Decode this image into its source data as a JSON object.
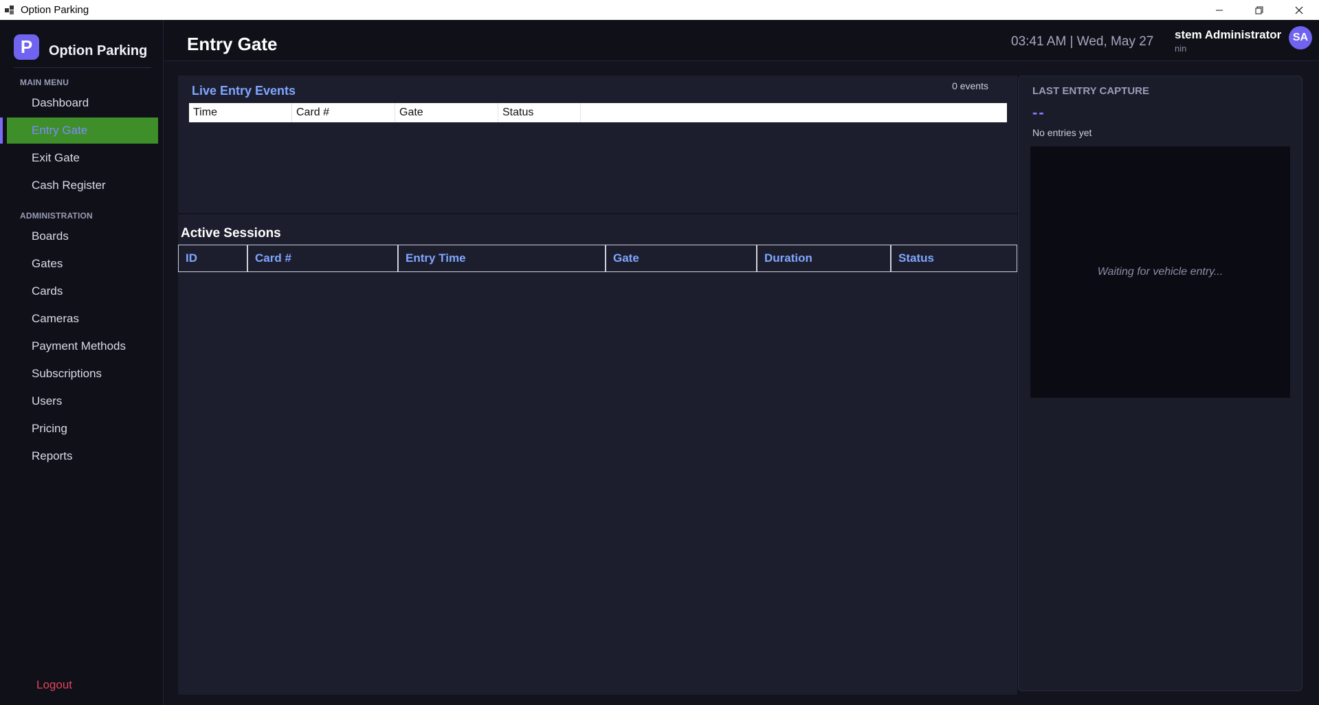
{
  "window": {
    "title": "Option Parking",
    "icon": "app-window-icon"
  },
  "brand": {
    "logo_letter": "P",
    "name": "Option Parking",
    "accent": "#6f63f0"
  },
  "sidebar": {
    "main_menu_label": "MAIN MENU",
    "main_items": [
      {
        "label": "Dashboard"
      },
      {
        "label": "Entry Gate",
        "active": true
      },
      {
        "label": "Exit Gate"
      },
      {
        "label": "Cash Register"
      }
    ],
    "admin_label": "ADMINISTRATION",
    "admin_items": [
      {
        "label": "Boards"
      },
      {
        "label": "Gates"
      },
      {
        "label": "Cards"
      },
      {
        "label": "Cameras"
      },
      {
        "label": "Payment Methods"
      },
      {
        "label": "Subscriptions"
      },
      {
        "label": "Users"
      },
      {
        "label": "Pricing"
      },
      {
        "label": "Reports"
      }
    ],
    "logout_label": "Logout",
    "active_color": "#3e8e2a"
  },
  "header": {
    "title": "Entry Gate",
    "clock": "03:41 AM  |  Wed, May 27",
    "user_name": "stem Administrator",
    "user_role": "nin",
    "avatar_initials": "SA"
  },
  "live_events": {
    "title": "Live Entry Events",
    "count_label": "0 events",
    "columns": [
      "Time",
      "Card #",
      "Gate",
      "Status"
    ]
  },
  "sessions": {
    "title": "Active Sessions",
    "columns": [
      "ID",
      "Card #",
      "Entry Time",
      "Gate",
      "Duration",
      "Status"
    ]
  },
  "capture": {
    "title": "LAST ENTRY CAPTURE",
    "plate": "--",
    "subtitle": "No entries yet",
    "placeholder": "Waiting for vehicle entry..."
  }
}
